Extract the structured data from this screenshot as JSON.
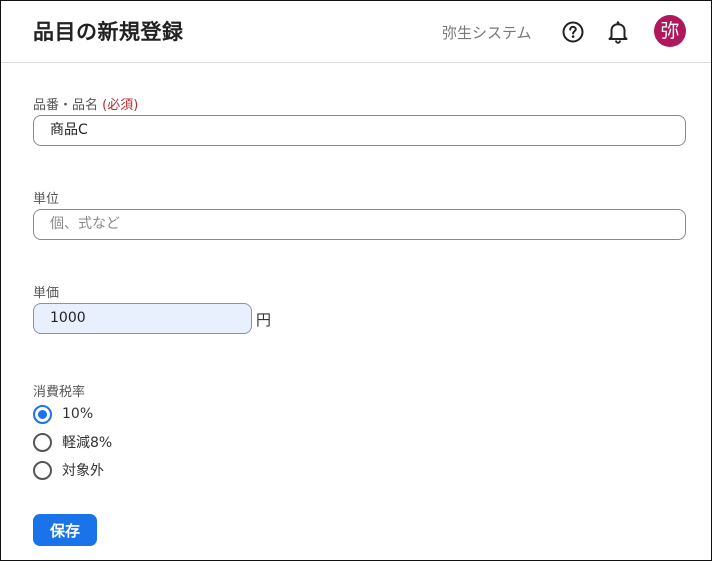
{
  "header": {
    "title": "品目の新規登録",
    "company": "弥生システム",
    "avatar_text": "弥",
    "icons": [
      "help-circle-icon",
      "bell-icon"
    ]
  },
  "form": {
    "item_name": {
      "label": "品番・品名",
      "required": "(必須)",
      "value": "商品C"
    },
    "unit": {
      "label": "単位",
      "placeholder": "個、式など",
      "value": ""
    },
    "price": {
      "label": "単価",
      "value": "1000",
      "suffix": "円"
    },
    "tax": {
      "label": "消費税率",
      "options": [
        {
          "label": "10%",
          "selected": true
        },
        {
          "label": "軽減8%",
          "selected": false
        },
        {
          "label": "対象外",
          "selected": false
        }
      ]
    },
    "save_label": "保存"
  },
  "colors": {
    "accent": "#1a73e8",
    "avatar": "#b0185c",
    "required": "#b42e2e"
  }
}
